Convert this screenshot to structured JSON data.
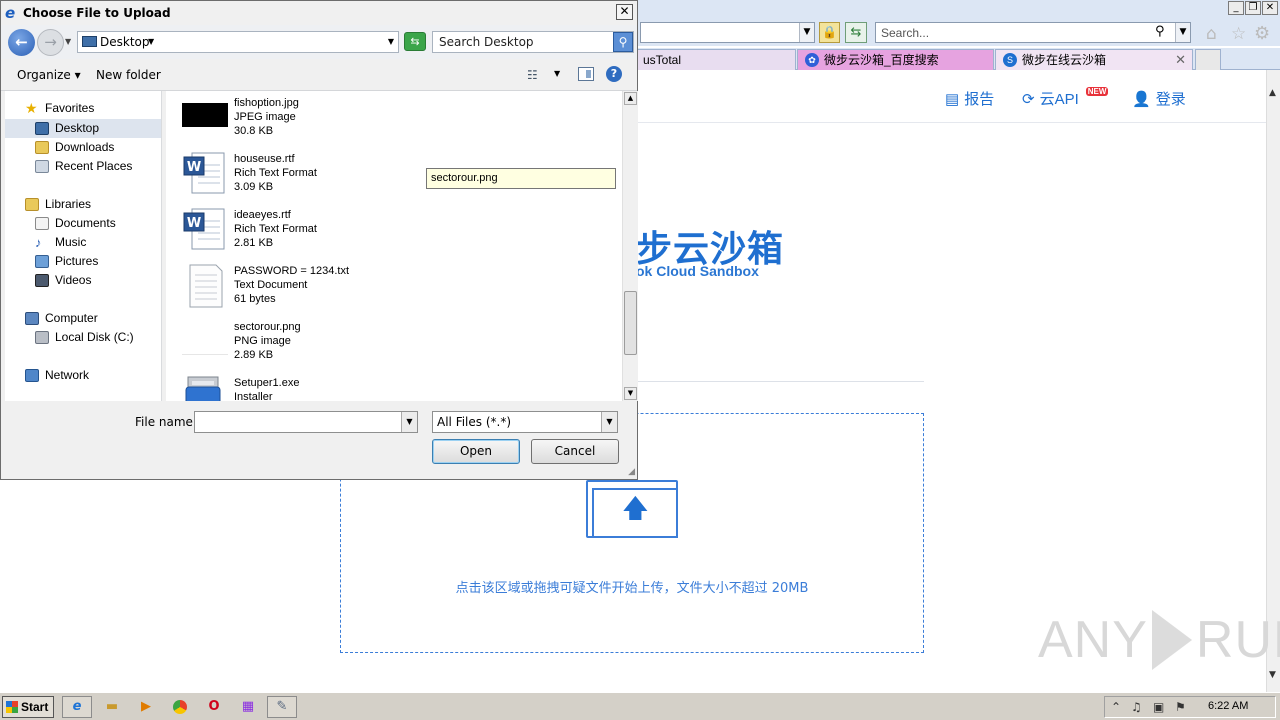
{
  "browser": {
    "search_placeholder": "Search...",
    "tabs": [
      {
        "label": "usTotal"
      },
      {
        "label": "微步云沙箱_百度搜索"
      },
      {
        "label": "微步在线云沙箱"
      }
    ]
  },
  "page": {
    "nav": {
      "report": "报告",
      "api": "云API",
      "api_badge": "NEW",
      "login": "登录"
    },
    "logo_cn": "步云沙箱",
    "logo_en": "ok Cloud Sandbox",
    "upload_hint": "点击该区域或拖拽可疑文件开始上传，文件大小不超过 20MB",
    "watermark": "ANY RUN"
  },
  "dialog": {
    "title": "Choose File to Upload",
    "location": "Desktop",
    "search_placeholder": "Search Desktop",
    "toolbar": {
      "organize": "Organize",
      "new_folder": "New folder"
    },
    "nav_pane": {
      "favorites": "Favorites",
      "desktop": "Desktop",
      "downloads": "Downloads",
      "recent_places": "Recent Places",
      "libraries": "Libraries",
      "documents": "Documents",
      "music": "Music",
      "pictures": "Pictures",
      "videos": "Videos",
      "computer": "Computer",
      "local_disk": "Local Disk (C:)",
      "network": "Network"
    },
    "files": [
      {
        "name": "fishoption.jpg",
        "type": "JPEG image",
        "size": "30.8 KB",
        "icon": "jpeg-thumb"
      },
      {
        "name": "houseuse.rtf",
        "type": "Rich Text Format",
        "size": "3.09 KB",
        "icon": "word-doc-icon"
      },
      {
        "name": "ideaeyes.rtf",
        "type": "Rich Text Format",
        "size": "2.81 KB",
        "icon": "word-doc-icon"
      },
      {
        "name": "PASSWORD = 1234.txt",
        "type": "Text Document",
        "size": "61 bytes",
        "icon": "text-doc-icon"
      },
      {
        "name": "sectorour.png",
        "type": "PNG image",
        "size": "2.89 KB",
        "icon": "png-thumb"
      },
      {
        "name": "Setuper1.exe",
        "type": "Installer",
        "size": "",
        "icon": "installer-icon"
      }
    ],
    "tooltip": "sectorour.png",
    "file_name_label": "File name:",
    "file_name_value": "",
    "file_type": "All Files (*.*)",
    "open_label": "Open",
    "cancel_label": "Cancel"
  },
  "taskbar": {
    "start_label": "Start",
    "clock": "6:22 AM"
  }
}
